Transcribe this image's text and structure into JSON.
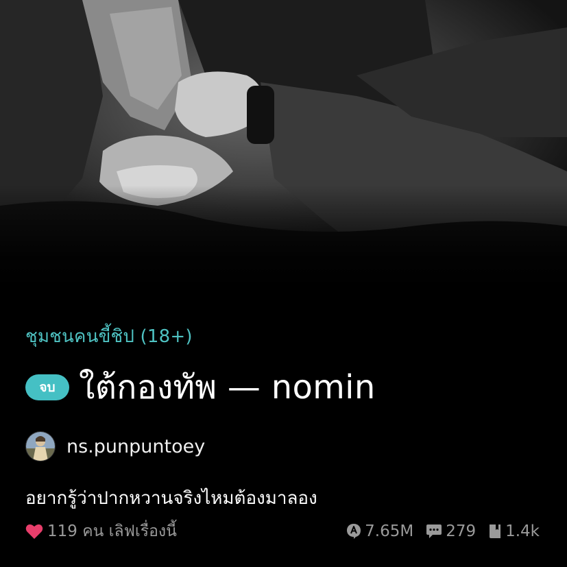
{
  "story": {
    "category": "ชุมชนคนขี้ชิป (18+)",
    "status_badge": "จบ",
    "title": "ใต้กองทัพ  — nomin",
    "author": "ns.punpuntoey",
    "synopsis": "อยากรู้ว่าปากหวานจริงไหมต้องมาลอง"
  },
  "stats": {
    "love_text": "119 คน เลิฟเรื่องนี้",
    "views": "7.65M",
    "comments": "279",
    "chapters": "1.4k"
  },
  "icons": {
    "love": "heart-icon",
    "views": "views-icon",
    "comments": "comment-bubble-icon",
    "chapters": "book-icon"
  },
  "colors": {
    "accent": "#4fc3c3",
    "badge_bg": "#45c0c4",
    "heart": "#e83e6b",
    "muted": "#9a9a9a",
    "background": "#000000"
  }
}
